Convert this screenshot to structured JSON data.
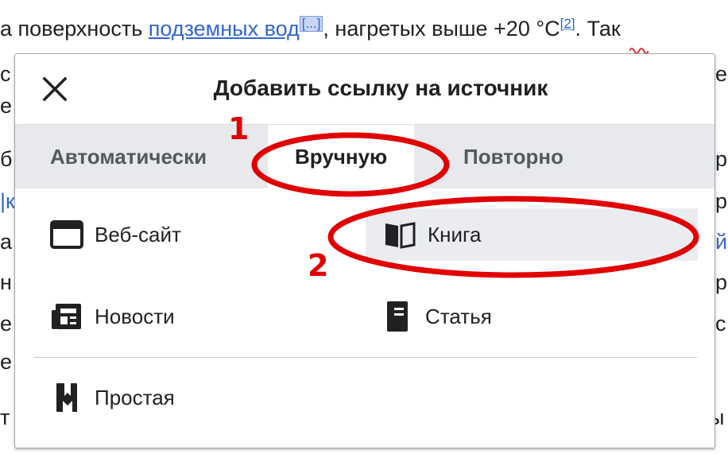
{
  "background": {
    "line1": {
      "prefix": "а поверхность ",
      "link": "подземных вод",
      "ref_marker": "[...]",
      "middle": ", нагретых выше +20 °C",
      "sup": "[2]",
      "suffix": ". Так"
    },
    "left_fragments": [
      "с",
      "е",
      "б",
      "|к",
      "а",
      "н",
      "е",
      "е",
      "т"
    ],
    "right_fragments": [
      "е",
      "р",
      "р",
      "й",
      "р",
      "с",
      "ы"
    ]
  },
  "dialog": {
    "title": "Добавить ссылку на источник",
    "close_icon": "close-icon",
    "tabs": [
      {
        "label": "Автоматически",
        "active": false
      },
      {
        "label": "Вручную",
        "active": true
      },
      {
        "label": "Повторно",
        "active": false
      }
    ],
    "options": [
      {
        "label": "Веб-сайт",
        "icon": "browser-icon"
      },
      {
        "label": "Книга",
        "icon": "book-icon",
        "highlighted": true
      },
      {
        "label": "Новости",
        "icon": "newspaper-icon"
      },
      {
        "label": "Статья",
        "icon": "journal-icon"
      },
      {
        "label": "Простая",
        "icon": "bookmark-icon"
      }
    ]
  },
  "annotations": {
    "marker_1": "1",
    "marker_2": "2",
    "color": "#e00000"
  },
  "colors": {
    "link": "#3366cc",
    "tab_bar": "#e8e9ec",
    "highlight": "#eaecf0"
  }
}
